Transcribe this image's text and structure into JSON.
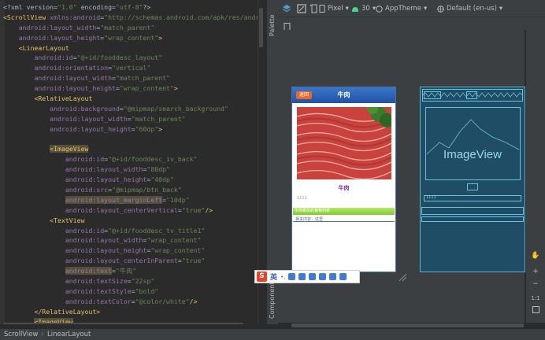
{
  "editor": {
    "lines": [
      [
        {
          "c": "t-plain",
          "t": "<?xml version="
        },
        {
          "c": "t-str",
          "t": "\"1.0\""
        },
        {
          "c": "t-plain",
          "t": " encoding="
        },
        {
          "c": "t-str",
          "t": "\"utf-8\""
        },
        {
          "c": "t-plain",
          "t": "?>"
        }
      ],
      [
        {
          "c": "t-tag",
          "t": "<ScrollView "
        },
        {
          "c": "t-attr",
          "t": "xmlns:android"
        },
        {
          "c": "t-eq",
          "t": "="
        },
        {
          "c": "t-str",
          "t": "\"http://schemas.android.com/apk/res/android\""
        }
      ],
      [
        {
          "c": "t-plain",
          "t": "    "
        },
        {
          "c": "t-attr",
          "t": "android:layout_width"
        },
        {
          "c": "t-eq",
          "t": "="
        },
        {
          "c": "t-str",
          "t": "\"match_parent\""
        }
      ],
      [
        {
          "c": "t-plain",
          "t": "    "
        },
        {
          "c": "t-attr",
          "t": "android:layout_height"
        },
        {
          "c": "t-eq",
          "t": "="
        },
        {
          "c": "t-str",
          "t": "\"wrap_content\""
        },
        {
          "c": "t-tag",
          "t": ">"
        }
      ],
      [
        {
          "c": "t-plain",
          "t": "    "
        },
        {
          "c": "t-tag",
          "t": "<LinearLayout"
        }
      ],
      [
        {
          "c": "t-plain",
          "t": "        "
        },
        {
          "c": "t-attr",
          "t": "android:id"
        },
        {
          "c": "t-eq",
          "t": "="
        },
        {
          "c": "t-str",
          "t": "\"@+id/fooddesc_layout\""
        }
      ],
      [
        {
          "c": "t-plain",
          "t": "        "
        },
        {
          "c": "t-attr",
          "t": "android:orientation"
        },
        {
          "c": "t-eq",
          "t": "="
        },
        {
          "c": "t-str",
          "t": "\"vertical\""
        }
      ],
      [
        {
          "c": "t-plain",
          "t": "        "
        },
        {
          "c": "t-attr",
          "t": "android:layout_width"
        },
        {
          "c": "t-eq",
          "t": "="
        },
        {
          "c": "t-str",
          "t": "\"match_parent\""
        }
      ],
      [
        {
          "c": "t-plain",
          "t": "        "
        },
        {
          "c": "t-attr",
          "t": "android:layout_height"
        },
        {
          "c": "t-eq",
          "t": "="
        },
        {
          "c": "t-str",
          "t": "\"wrap_content\""
        },
        {
          "c": "t-tag",
          "t": ">"
        }
      ],
      [
        {
          "c": "t-plain",
          "t": "        "
        },
        {
          "c": "t-tag",
          "t": "<RelativeLayout"
        }
      ],
      [
        {
          "c": "t-plain",
          "t": "            "
        },
        {
          "c": "t-attr",
          "t": "android:background"
        },
        {
          "c": "t-eq",
          "t": "="
        },
        {
          "c": "t-str",
          "t": "\"@mipmap/search_background\""
        }
      ],
      [
        {
          "c": "t-plain",
          "t": "            "
        },
        {
          "c": "t-attr",
          "t": "android:layout_width"
        },
        {
          "c": "t-eq",
          "t": "="
        },
        {
          "c": "t-str",
          "t": "\"match_parent\""
        }
      ],
      [
        {
          "c": "t-plain",
          "t": "            "
        },
        {
          "c": "t-attr",
          "t": "android:layout_height"
        },
        {
          "c": "t-eq",
          "t": "="
        },
        {
          "c": "t-str",
          "t": "\"60dp\""
        },
        {
          "c": "t-tag",
          "t": ">"
        }
      ],
      [],
      [
        {
          "c": "t-plain",
          "t": "            "
        },
        {
          "c": "t-tag t-bg-hl",
          "t": "<ImageView"
        }
      ],
      [
        {
          "c": "t-plain",
          "t": "                "
        },
        {
          "c": "t-attr",
          "t": "android:id"
        },
        {
          "c": "t-eq",
          "t": "="
        },
        {
          "c": "t-str",
          "t": "\"@+id/fooddesc_iv_back\""
        }
      ],
      [
        {
          "c": "t-plain",
          "t": "                "
        },
        {
          "c": "t-attr",
          "t": "android:layout_width"
        },
        {
          "c": "t-eq",
          "t": "="
        },
        {
          "c": "t-str",
          "t": "\"80dp\""
        }
      ],
      [
        {
          "c": "t-plain",
          "t": "                "
        },
        {
          "c": "t-attr",
          "t": "android:layout_height"
        },
        {
          "c": "t-eq",
          "t": "="
        },
        {
          "c": "t-str",
          "t": "\"40dp\""
        }
      ],
      [
        {
          "c": "t-plain",
          "t": "                "
        },
        {
          "c": "t-attr",
          "t": "android:src"
        },
        {
          "c": "t-eq",
          "t": "="
        },
        {
          "c": "t-str",
          "t": "\"@mipmap/btn_back\""
        }
      ],
      [
        {
          "c": "t-plain",
          "t": "                "
        },
        {
          "c": "t-attr t-bg-hl",
          "t": "android:layout_marginLeft"
        },
        {
          "c": "t-eq",
          "t": "="
        },
        {
          "c": "t-str",
          "t": "\"10dp\""
        }
      ],
      [
        {
          "c": "t-plain",
          "t": "                "
        },
        {
          "c": "t-attr",
          "t": "android:layout_centerVertical"
        },
        {
          "c": "t-eq",
          "t": "="
        },
        {
          "c": "t-str",
          "t": "\"true\""
        },
        {
          "c": "t-tag",
          "t": "/>"
        }
      ],
      [
        {
          "c": "t-plain",
          "t": "            "
        },
        {
          "c": "t-tag",
          "t": "<TextView"
        }
      ],
      [
        {
          "c": "t-plain",
          "t": "                "
        },
        {
          "c": "t-attr",
          "t": "android:id"
        },
        {
          "c": "t-eq",
          "t": "="
        },
        {
          "c": "t-str",
          "t": "\"@+id/fooddesc_tv_title1\""
        }
      ],
      [
        {
          "c": "t-plain",
          "t": "                "
        },
        {
          "c": "t-attr",
          "t": "android:layout_width"
        },
        {
          "c": "t-eq",
          "t": "="
        },
        {
          "c": "t-str",
          "t": "\"wrap_content\""
        }
      ],
      [
        {
          "c": "t-plain",
          "t": "                "
        },
        {
          "c": "t-attr",
          "t": "android:layout_height"
        },
        {
          "c": "t-eq",
          "t": "="
        },
        {
          "c": "t-str",
          "t": "\"wrap_content\""
        }
      ],
      [
        {
          "c": "t-plain",
          "t": "                "
        },
        {
          "c": "t-attr",
          "t": "android:layout_centerInParent"
        },
        {
          "c": "t-eq",
          "t": "="
        },
        {
          "c": "t-str",
          "t": "\"true\""
        }
      ],
      [
        {
          "c": "t-plain",
          "t": "                "
        },
        {
          "c": "t-attr t-bg-hl",
          "t": "android:text"
        },
        {
          "c": "t-eq",
          "t": "="
        },
        {
          "c": "t-str",
          "t": "\"牛肉\""
        }
      ],
      [
        {
          "c": "t-plain",
          "t": "                "
        },
        {
          "c": "t-attr",
          "t": "android:textSize"
        },
        {
          "c": "t-eq",
          "t": "="
        },
        {
          "c": "t-str",
          "t": "\"22sp\""
        }
      ],
      [
        {
          "c": "t-plain",
          "t": "                "
        },
        {
          "c": "t-attr",
          "t": "android:textStyle"
        },
        {
          "c": "t-eq",
          "t": "="
        },
        {
          "c": "t-str",
          "t": "\"bold\""
        }
      ],
      [
        {
          "c": "t-plain",
          "t": "                "
        },
        {
          "c": "t-attr",
          "t": "android:textColor"
        },
        {
          "c": "t-eq",
          "t": "="
        },
        {
          "c": "t-str",
          "t": "\"@color/white\""
        },
        {
          "c": "t-tag",
          "t": "/>"
        }
      ],
      [
        {
          "c": "t-plain",
          "t": "        "
        },
        {
          "c": "t-tag",
          "t": "</RelativeLayout>"
        }
      ],
      [
        {
          "c": "t-plain",
          "t": "        "
        },
        {
          "c": "t-tag t-bg-hl",
          "t": "<ImageView"
        }
      ]
    ]
  },
  "sidebar": {
    "palette_label": "Palette",
    "component_label": "Component"
  },
  "toolbar": {
    "device": "Pixel",
    "api": "30",
    "theme": "AppTheme",
    "locale": "Default (en-us)"
  },
  "phone": {
    "back_label": "返回",
    "title": "牛肉",
    "food_name": "牛肉",
    "small_text": "1111",
    "green_bar": "牛肉相关的食物列表",
    "sub_text": "相关内容，这里"
  },
  "blueprint": {
    "image_label": "ImageView",
    "small_text": "1111"
  },
  "right_tools": {
    "zoom_in": "+",
    "zoom_out": "−",
    "one_to_one": "1:1"
  },
  "ime": {
    "logo": "S",
    "lang": "英"
  },
  "status": {
    "crumb1": "ScrollView",
    "crumb2": "LinearLayout"
  },
  "colors": {
    "tag": "#e8bf6a",
    "attr": "#9876aa",
    "string": "#6a8759",
    "blueprint_bg": "#1f4d66",
    "blueprint_line": "#6cc3dd"
  }
}
